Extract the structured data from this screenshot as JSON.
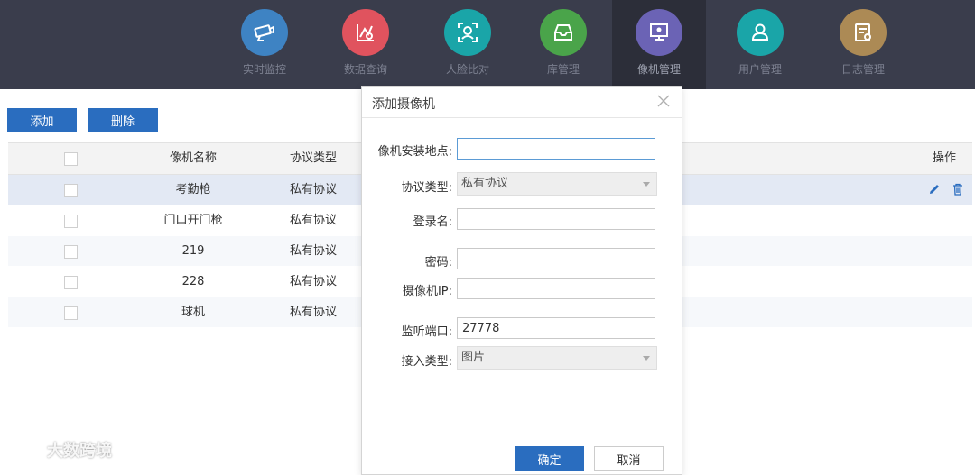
{
  "nav": {
    "items": [
      {
        "label": "实时监控",
        "icon": "camera-icon",
        "color": "#3e83c3"
      },
      {
        "label": "数据查询",
        "icon": "data-query-icon",
        "color": "#e0535e"
      },
      {
        "label": "人脸比对",
        "icon": "face-compare-icon",
        "color": "#1aa5a8"
      },
      {
        "label": "库管理",
        "icon": "inbox-icon",
        "color": "#4aa44a"
      },
      {
        "label": "像机管理",
        "icon": "monitor-icon",
        "color": "#6b63b5",
        "active": true
      },
      {
        "label": "用户管理",
        "icon": "user-icon",
        "color": "#1aa5a8"
      },
      {
        "label": "日志管理",
        "icon": "log-icon",
        "color": "#ac8a55"
      }
    ]
  },
  "toolbar": {
    "add_label": "添加",
    "delete_label": "删除"
  },
  "table": {
    "headers": {
      "name": "像机名称",
      "protocol": "协议类型",
      "ops": "操作"
    },
    "rows": [
      {
        "name": "考勤枪",
        "protocol": "私有协议"
      },
      {
        "name": "门口开门枪",
        "protocol": "私有协议"
      },
      {
        "name": "219",
        "protocol": "私有协议"
      },
      {
        "name": "228",
        "protocol": "私有协议"
      },
      {
        "name": "球机",
        "protocol": "私有协议"
      }
    ]
  },
  "dialog": {
    "title": "添加摄像机",
    "fields": {
      "location_label": "像机安装地点:",
      "location_value": "",
      "protocol_label": "协议类型:",
      "protocol_value": "私有协议",
      "login_label": "登录名:",
      "login_value": "",
      "password_label": "密码:",
      "password_value": "",
      "ip_label": "摄像机IP:",
      "ip_value": "",
      "port_label": "监听端口:",
      "port_value": "27778",
      "access_label": "接入类型:",
      "access_value": "图片"
    },
    "ok_label": "确定",
    "cancel_label": "取消"
  },
  "watermark": "大数跨境",
  "colors": {
    "nav_bg": "#3a3d4c",
    "accent": "#2a6dbf",
    "selected_row": "#e3e9f4"
  }
}
